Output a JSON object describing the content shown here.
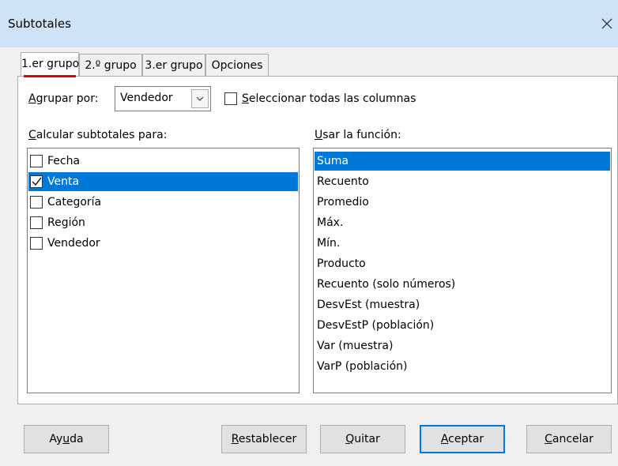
{
  "dialog": {
    "title": "Subtotales"
  },
  "tabs": [
    {
      "label": "1.er grupo"
    },
    {
      "label": "2.º grupo"
    },
    {
      "label": "3.er grupo"
    },
    {
      "label": "Opciones"
    }
  ],
  "group_by": {
    "label_first": "A",
    "label_rest": "grupar por:",
    "value": "Vendedor"
  },
  "select_all": {
    "label_first": "S",
    "label_rest": "eleccionar todas las columnas",
    "checked": false
  },
  "columns": {
    "label_first": "C",
    "label_rest": "alcular subtotales para:",
    "items": [
      {
        "label": "Fecha",
        "checked": false,
        "selected": false
      },
      {
        "label": "Venta",
        "checked": true,
        "selected": true
      },
      {
        "label": "Categoría",
        "checked": false,
        "selected": false
      },
      {
        "label": "Región",
        "checked": false,
        "selected": false
      },
      {
        "label": "Vendedor",
        "checked": false,
        "selected": false
      }
    ]
  },
  "functions": {
    "label_first": "U",
    "label_rest": "sar la función:",
    "items": [
      {
        "label": "Suma",
        "selected": true
      },
      {
        "label": "Recuento"
      },
      {
        "label": "Promedio"
      },
      {
        "label": "Máx."
      },
      {
        "label": "Mín."
      },
      {
        "label": "Producto"
      },
      {
        "label": "Recuento (solo números)"
      },
      {
        "label": "DesvEst (muestra)"
      },
      {
        "label": "DesvEstP (población)"
      },
      {
        "label": "Var (muestra)"
      },
      {
        "label": "VarP (población)"
      }
    ]
  },
  "buttons": {
    "help": {
      "a": "Ay",
      "u": "u",
      "b": "da"
    },
    "reset": {
      "a": "",
      "u": "R",
      "b": "establecer"
    },
    "remove": {
      "a": "",
      "u": "Q",
      "b": "uitar"
    },
    "ok": {
      "a": "",
      "u": "A",
      "b": "ceptar"
    },
    "cancel": {
      "a": "",
      "u": "C",
      "b": "ancelar"
    }
  },
  "colors": {
    "selection": "#0078d7",
    "titlebar": "#cfe3f7",
    "tab_indicator": "#d9001b"
  }
}
